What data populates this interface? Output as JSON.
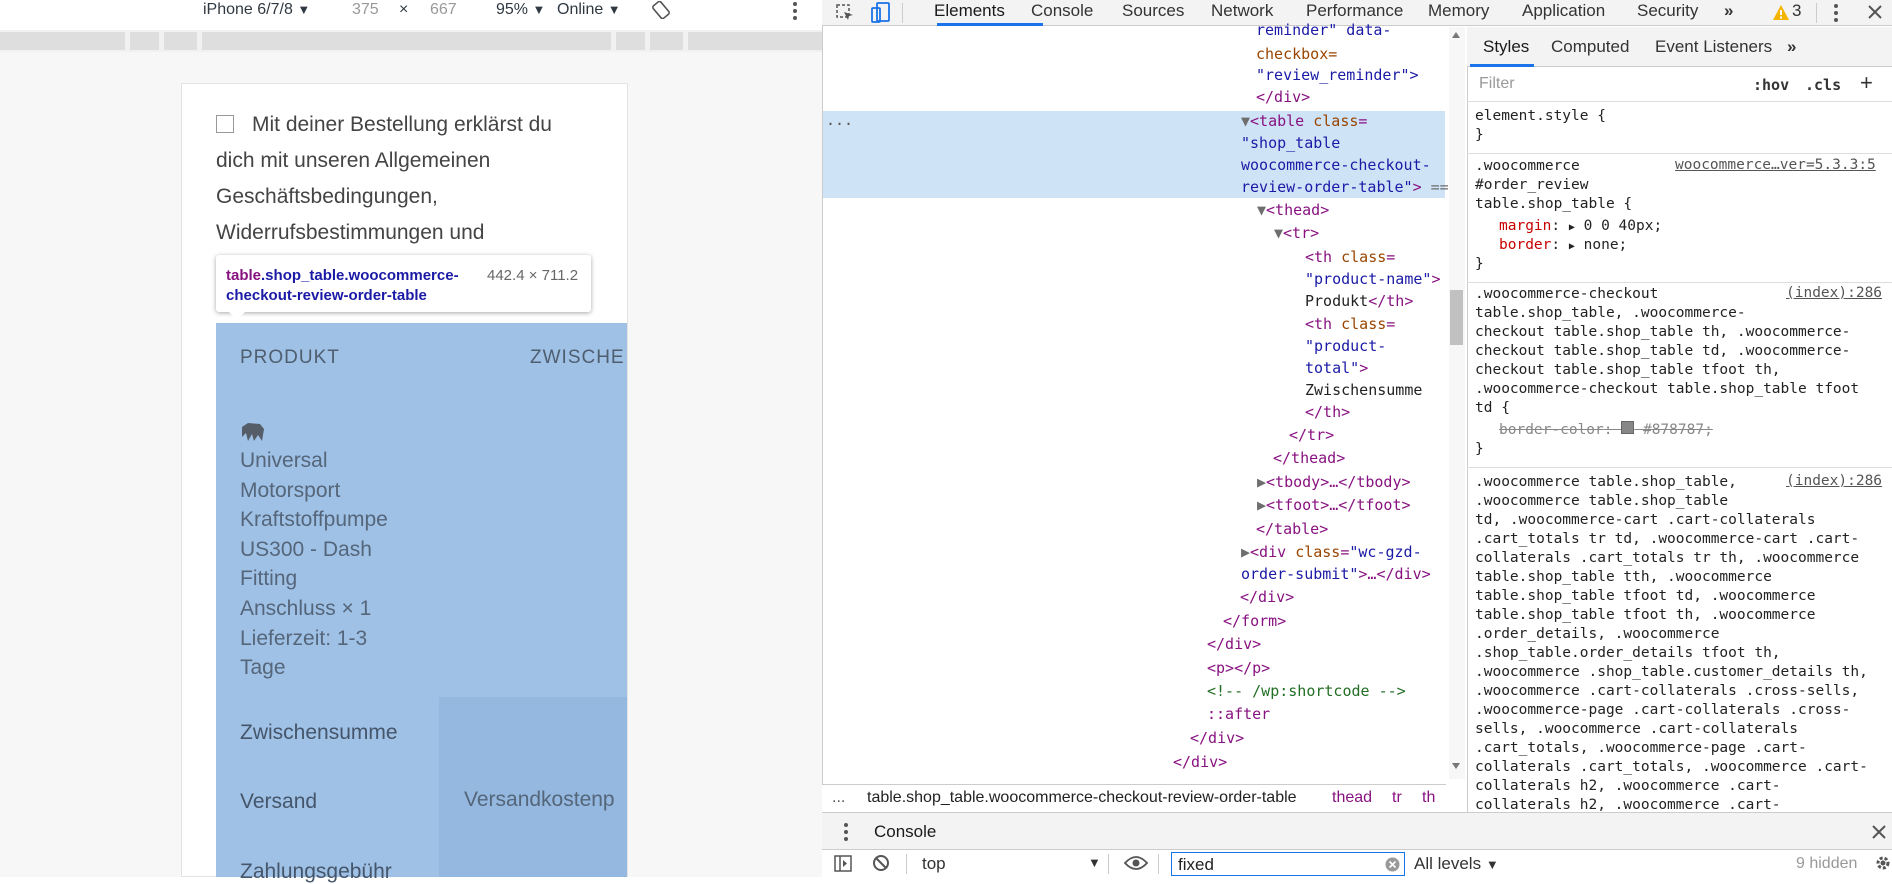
{
  "device_toolbar": {
    "device": "iPhone 6/7/8",
    "width": "375",
    "times": "×",
    "height": "667",
    "zoom": "95%",
    "network": "Online",
    "dropdown_arrow": "▼"
  },
  "page": {
    "terms_text": "Mit deiner Bestellung erklärst du dich mit unseren Allgemeinen Geschäftsbedingungen, Widerrufsbestimmungen und",
    "tooltip_selector_tag": "table",
    "tooltip_selector_classes": ".shop_table.woocommerce-checkout-review-order-table",
    "tooltip_size": "442.4 × 711.2",
    "th_product": "PRODUKT",
    "th_subtotal": "ZWISCHE",
    "product_lines": [
      "Universal",
      "Motorsport",
      "Kraftstoffpumpe",
      "US300 - Dash",
      "Fitting",
      "Anschluss  × 1",
      "Lieferzeit: 1-3",
      "Tage"
    ],
    "row_subtotal": "Zwischensumme",
    "row_shipping": "Versand",
    "row_shipping_value": "Versandkostenp",
    "row_fee": "Zahlungsgebühr"
  },
  "devtools": {
    "tabs": [
      "Elements",
      "Console",
      "Sources",
      "Network",
      "Performance",
      "Memory",
      "Application",
      "Security"
    ],
    "more_tabs": "»",
    "warning_count": "3",
    "active_tab": "Elements"
  },
  "dom_tree": {
    "line_reminder": "reminder\" data-",
    "line_checkbox": "checkbox=",
    "line_review_reminder": "\"review_reminder\">",
    "line_div_close": "</div>",
    "table_open": "<table",
    "class_attr": "class",
    "table_class_val1": "\"shop_table",
    "table_class_val2": "woocommerce-checkout-",
    "table_class_val3": "review-order-table\"",
    "eq_sign": "==",
    "thead_open": "<thead>",
    "tr_open": "<tr>",
    "th_open": "<th",
    "th_name_val": "\"product-name\"",
    "th_name_text": "Produkt",
    "th_close": "</th>",
    "th_total_val1": "\"product-",
    "th_total_val2": "total\"",
    "th_total_text": "Zwischensumme",
    "tr_close": "</tr>",
    "thead_close": "</thead>",
    "tbody_collapsed": "<tbody>…</tbody>",
    "tfoot_collapsed": "<tfoot>…</tfoot>",
    "table_close": "</table>",
    "div_open": "<div",
    "div_class_val1": "\"wc-gzd-",
    "div_class_val2": "order-submit\"",
    "div_collapsed_end": ">…</div>",
    "form_close": "</form>",
    "p_empty": "<p></p>",
    "comment": "<!-- /wp:shortcode -->",
    "after": "::after",
    "ellipsis": "..."
  },
  "breadcrumb": {
    "ellipsis": "...",
    "items": [
      "table.shop_table.woocommerce-checkout-review-order-table",
      "thead",
      "tr",
      "th"
    ]
  },
  "styles": {
    "tabs": [
      "Styles",
      "Computed",
      "Event Listeners"
    ],
    "more": "»",
    "filter_placeholder": "Filter",
    "hov": ":hov",
    "cls": ".cls",
    "plus": "+",
    "element_style": "element.style {",
    "brace_close": "}",
    "rule1_selector": [
      ".woocommerce",
      "#order_review",
      "table.shop_table {"
    ],
    "rule1_source": "woocommerce…ver=5.3.3:5",
    "rule1_margin_prop": "margin",
    "rule1_margin_val": "0 0 40px;",
    "rule1_border_prop": "border",
    "rule1_border_val": "none;",
    "rule2_selector": [
      ".woocommerce-checkout",
      "table.shop_table, .woocommerce-",
      "checkout table.shop_table th, .woocommerce-",
      "checkout table.shop_table td, .woocommerce-",
      "checkout table.shop_table tfoot th,",
      ".woocommerce-checkout table.shop_table tfoot",
      "td {"
    ],
    "rule2_source": "(index):286",
    "rule2_prop": "border-color",
    "rule2_val": "#878787;",
    "rule2_swatch": "#878787",
    "rule3_selector": [
      ".woocommerce table.shop_table,",
      ".woocommerce table.shop_table",
      "td, .woocommerce-cart .cart-collaterals",
      ".cart_totals tr td, .woocommerce-cart .cart-",
      "collaterals .cart_totals tr th, .woocommerce",
      "table.shop_table tth, .woocommerce",
      "table.shop_table tfoot td, .woocommerce",
      "table.shop_table tfoot th, .woocommerce",
      ".order_details, .woocommerce",
      ".shop_table.order_details tfoot th,",
      ".woocommerce .shop_table.customer_details th,",
      ".woocommerce .cart-collaterals .cross-sells,",
      ".woocommerce-page .cart-collaterals .cross-",
      "sells, .woocommerce .cart-collaterals",
      ".cart_totals, .woocommerce-page .cart-",
      "collaterals .cart_totals, .woocommerce .cart-",
      "collaterals h2, .woocommerce .cart-",
      "collaterals h2, .woocommerce .cart-"
    ],
    "rule3_source": "(index):286"
  },
  "console": {
    "title": "Console",
    "context": "top",
    "filter_value": "fixed",
    "levels": "All levels",
    "hidden": "9 hidden"
  },
  "colors": {
    "accent": "#1a73e8",
    "highlight": "#9fc1e6",
    "dom_selected": "#cfe3f7"
  }
}
